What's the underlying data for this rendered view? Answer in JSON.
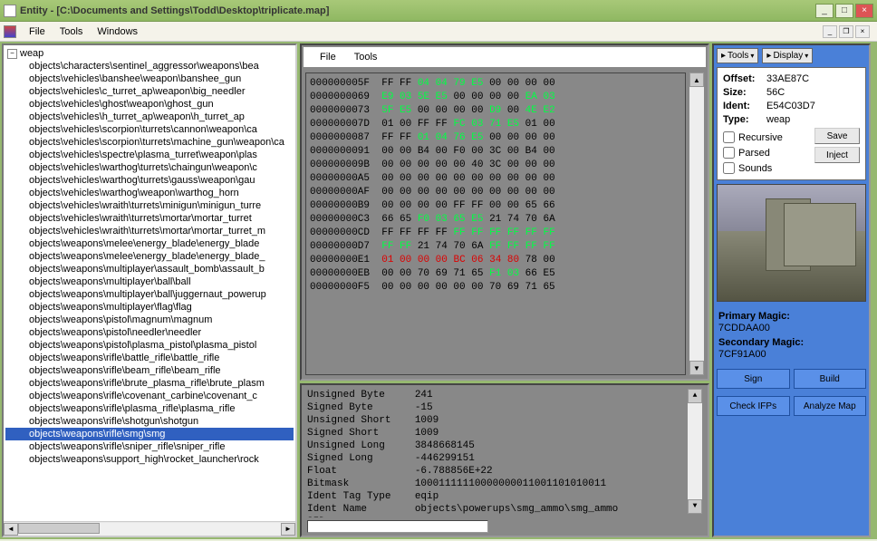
{
  "title": "Entity - [C:\\Documents and Settings\\Todd\\Desktop\\triplicate.map]",
  "menu": {
    "file": "File",
    "tools": "Tools",
    "windows": "Windows"
  },
  "tree": {
    "root": "weap",
    "items": [
      "objects\\characters\\sentinel_aggressor\\weapons\\bea",
      "objects\\vehicles\\banshee\\weapon\\banshee_gun",
      "objects\\vehicles\\c_turret_ap\\weapon\\big_needler",
      "objects\\vehicles\\ghost\\weapon\\ghost_gun",
      "objects\\vehicles\\h_turret_ap\\weapon\\h_turret_ap",
      "objects\\vehicles\\scorpion\\turrets\\cannon\\weapon\\ca",
      "objects\\vehicles\\scorpion\\turrets\\machine_gun\\weapon\\ca",
      "objects\\vehicles\\spectre\\plasma_turret\\weapon\\plas",
      "objects\\vehicles\\warthog\\turrets\\chaingun\\weapon\\c",
      "objects\\vehicles\\warthog\\turrets\\gauss\\weapon\\gau",
      "objects\\vehicles\\warthog\\weapon\\warthog_horn",
      "objects\\vehicles\\wraith\\turrets\\minigun\\minigun_turre",
      "objects\\vehicles\\wraith\\turrets\\mortar\\mortar_turret",
      "objects\\vehicles\\wraith\\turrets\\mortar\\mortar_turret_m",
      "objects\\weapons\\melee\\energy_blade\\energy_blade",
      "objects\\weapons\\melee\\energy_blade\\energy_blade_",
      "objects\\weapons\\multiplayer\\assault_bomb\\assault_b",
      "objects\\weapons\\multiplayer\\ball\\ball",
      "objects\\weapons\\multiplayer\\ball\\juggernaut_powerup",
      "objects\\weapons\\multiplayer\\flag\\flag",
      "objects\\weapons\\pistol\\magnum\\magnum",
      "objects\\weapons\\pistol\\needler\\needler",
      "objects\\weapons\\pistol\\plasma_pistol\\plasma_pistol",
      "objects\\weapons\\rifle\\battle_rifle\\battle_rifle",
      "objects\\weapons\\rifle\\beam_rifle\\beam_rifle",
      "objects\\weapons\\rifle\\brute_plasma_rifle\\brute_plasm",
      "objects\\weapons\\rifle\\covenant_carbine\\covenant_c",
      "objects\\weapons\\rifle\\plasma_rifle\\plasma_rifle",
      "objects\\weapons\\rifle\\shotgun\\shotgun",
      "objects\\weapons\\rifle\\smg\\smg",
      "objects\\weapons\\rifle\\sniper_rifle\\sniper_rifle",
      "objects\\weapons\\support_high\\rocket_launcher\\rock"
    ],
    "selected": 29
  },
  "hexmenu": {
    "file": "File",
    "tools": "Tools"
  },
  "hex": [
    {
      "a": "000000005F",
      "b": [
        [
          "FF",
          0
        ],
        [
          "FF",
          0
        ],
        [
          "04",
          1
        ],
        [
          "04",
          1
        ],
        [
          "79",
          1
        ],
        [
          "E5",
          1
        ],
        [
          "00",
          0
        ],
        [
          "00",
          0
        ],
        [
          "00",
          0
        ],
        [
          "00",
          0
        ]
      ]
    },
    {
      "a": "0000000069",
      "b": [
        [
          "E9",
          1
        ],
        [
          "03",
          1
        ],
        [
          "5E",
          1
        ],
        [
          "E5",
          1
        ],
        [
          "00",
          0
        ],
        [
          "00",
          0
        ],
        [
          "00",
          0
        ],
        [
          "00",
          0
        ],
        [
          "EA",
          1
        ],
        [
          "03",
          1
        ]
      ]
    },
    {
      "a": "0000000073",
      "b": [
        [
          "5F",
          1
        ],
        [
          "E5",
          1
        ],
        [
          "00",
          0
        ],
        [
          "00",
          0
        ],
        [
          "00",
          0
        ],
        [
          "00",
          0
        ],
        [
          "D9",
          1
        ],
        [
          "00",
          0
        ],
        [
          "4E",
          1
        ],
        [
          "E2",
          1
        ]
      ]
    },
    {
      "a": "000000007D",
      "b": [
        [
          "01",
          0
        ],
        [
          "00",
          0
        ],
        [
          "FF",
          0
        ],
        [
          "FF",
          0
        ],
        [
          "FC",
          1
        ],
        [
          "03",
          1
        ],
        [
          "71",
          1
        ],
        [
          "E5",
          1
        ],
        [
          "01",
          0
        ],
        [
          "00",
          0
        ]
      ]
    },
    {
      "a": "0000000087",
      "b": [
        [
          "FF",
          0
        ],
        [
          "FF",
          0
        ],
        [
          "01",
          1
        ],
        [
          "04",
          1
        ],
        [
          "76",
          1
        ],
        [
          "E5",
          1
        ],
        [
          "00",
          0
        ],
        [
          "00",
          0
        ],
        [
          "00",
          0
        ],
        [
          "00",
          0
        ]
      ]
    },
    {
      "a": "0000000091",
      "b": [
        [
          "00",
          0
        ],
        [
          "00",
          0
        ],
        [
          "B4",
          0
        ],
        [
          "00",
          0
        ],
        [
          "F0",
          0
        ],
        [
          "00",
          0
        ],
        [
          "3C",
          0
        ],
        [
          "00",
          0
        ],
        [
          "B4",
          0
        ],
        [
          "00",
          0
        ]
      ]
    },
    {
      "a": "000000009B",
      "b": [
        [
          "00",
          0
        ],
        [
          "00",
          0
        ],
        [
          "00",
          0
        ],
        [
          "00",
          0
        ],
        [
          "00",
          0
        ],
        [
          "40",
          0
        ],
        [
          "3C",
          0
        ],
        [
          "00",
          0
        ],
        [
          "00",
          0
        ],
        [
          "00",
          0
        ]
      ]
    },
    {
      "a": "00000000A5",
      "b": [
        [
          "00",
          0
        ],
        [
          "00",
          0
        ],
        [
          "00",
          0
        ],
        [
          "00",
          0
        ],
        [
          "00",
          0
        ],
        [
          "00",
          0
        ],
        [
          "00",
          0
        ],
        [
          "00",
          0
        ],
        [
          "00",
          0
        ],
        [
          "00",
          0
        ]
      ]
    },
    {
      "a": "00000000AF",
      "b": [
        [
          "00",
          0
        ],
        [
          "00",
          0
        ],
        [
          "00",
          0
        ],
        [
          "00",
          0
        ],
        [
          "00",
          0
        ],
        [
          "00",
          0
        ],
        [
          "00",
          0
        ],
        [
          "00",
          0
        ],
        [
          "00",
          0
        ],
        [
          "00",
          0
        ]
      ]
    },
    {
      "a": "00000000B9",
      "b": [
        [
          "00",
          0
        ],
        [
          "00",
          0
        ],
        [
          "00",
          0
        ],
        [
          "00",
          0
        ],
        [
          "FF",
          0
        ],
        [
          "FF",
          0
        ],
        [
          "00",
          0
        ],
        [
          "00",
          0
        ],
        [
          "65",
          0
        ],
        [
          "66",
          0
        ]
      ]
    },
    {
      "a": "00000000C3",
      "b": [
        [
          "66",
          0
        ],
        [
          "65",
          0
        ],
        [
          "F0",
          1
        ],
        [
          "03",
          1
        ],
        [
          "65",
          1
        ],
        [
          "E5",
          1
        ],
        [
          "21",
          0
        ],
        [
          "74",
          0
        ],
        [
          "70",
          0
        ],
        [
          "6A",
          0
        ]
      ]
    },
    {
      "a": "00000000CD",
      "b": [
        [
          "FF",
          0
        ],
        [
          "FF",
          0
        ],
        [
          "FF",
          0
        ],
        [
          "FF",
          0
        ],
        [
          "FF",
          1
        ],
        [
          "FF",
          1
        ],
        [
          "FF",
          1
        ],
        [
          "FF",
          1
        ],
        [
          "FF",
          1
        ],
        [
          "FF",
          1
        ]
      ]
    },
    {
      "a": "00000000D7",
      "b": [
        [
          "FF",
          1
        ],
        [
          "FF",
          1
        ],
        [
          "21",
          0
        ],
        [
          "74",
          0
        ],
        [
          "70",
          0
        ],
        [
          "6A",
          0
        ],
        [
          "FF",
          1
        ],
        [
          "FF",
          1
        ],
        [
          "FF",
          1
        ],
        [
          "FF",
          1
        ]
      ]
    },
    {
      "a": "00000000E1",
      "b": [
        [
          "01",
          2
        ],
        [
          "00",
          2
        ],
        [
          "00",
          2
        ],
        [
          "00",
          2
        ],
        [
          "BC",
          2
        ],
        [
          "06",
          2
        ],
        [
          "34",
          2
        ],
        [
          "80",
          2
        ],
        [
          "78",
          0
        ],
        [
          "00",
          0
        ]
      ]
    },
    {
      "a": "00000000EB",
      "b": [
        [
          "00",
          0
        ],
        [
          "00",
          0
        ],
        [
          "70",
          0
        ],
        [
          "69",
          0
        ],
        [
          "71",
          0
        ],
        [
          "65",
          0
        ],
        [
          "F1",
          1
        ],
        [
          "03",
          1
        ],
        [
          "66",
          0
        ],
        [
          "E5",
          0
        ]
      ]
    },
    {
      "a": "00000000F5",
      "b": [
        [
          "00",
          0
        ],
        [
          "00",
          0
        ],
        [
          "00",
          0
        ],
        [
          "00",
          0
        ],
        [
          "00",
          0
        ],
        [
          "00",
          0
        ],
        [
          "70",
          0
        ],
        [
          "69",
          0
        ],
        [
          "71",
          0
        ],
        [
          "65",
          0
        ]
      ]
    }
  ],
  "info": {
    "ub_l": "Unsigned Byte",
    "ub_v": "241",
    "sb_l": "Signed Byte",
    "sb_v": "-15",
    "us_l": "Unsigned Short",
    "us_v": "1009",
    "ss_l": "Signed Short",
    "ss_v": "1009",
    "ul_l": "Unsigned Long",
    "ul_v": "3848668145",
    "sl_l": "Signed Long",
    "sl_v": "-446299151",
    "fl_l": "Float",
    "fl_v": "-6.788856E+22",
    "bm_l": "Bitmask",
    "bm_v": "10001111110000000011001101010011",
    "itt_l": "Ident Tag Type",
    "itt_v": "eqip",
    "itn_l": "Ident Name",
    "itn_v": "objects\\powerups\\smg_ammo\\smg_ammo",
    "sid_l": "SID"
  },
  "right": {
    "tools": "Tools",
    "display": "Display",
    "offset_l": "Offset:",
    "offset_v": "33AE87C",
    "size_l": "Size:",
    "size_v": "56C",
    "ident_l": "Ident:",
    "ident_v": "E54C03D7",
    "type_l": "Type:",
    "type_v": "weap",
    "recursive": "Recursive",
    "parsed": "Parsed",
    "sounds": "Sounds",
    "save": "Save",
    "inject": "Inject",
    "pm_l": "Primary Magic:",
    "pm_v": "7CDDAA00",
    "sm_l": "Secondary Magic:",
    "sm_v": "7CF91A00",
    "sign": "Sign",
    "build": "Build",
    "checkifps": "Check IFPs",
    "analyze": "Analyze Map"
  }
}
